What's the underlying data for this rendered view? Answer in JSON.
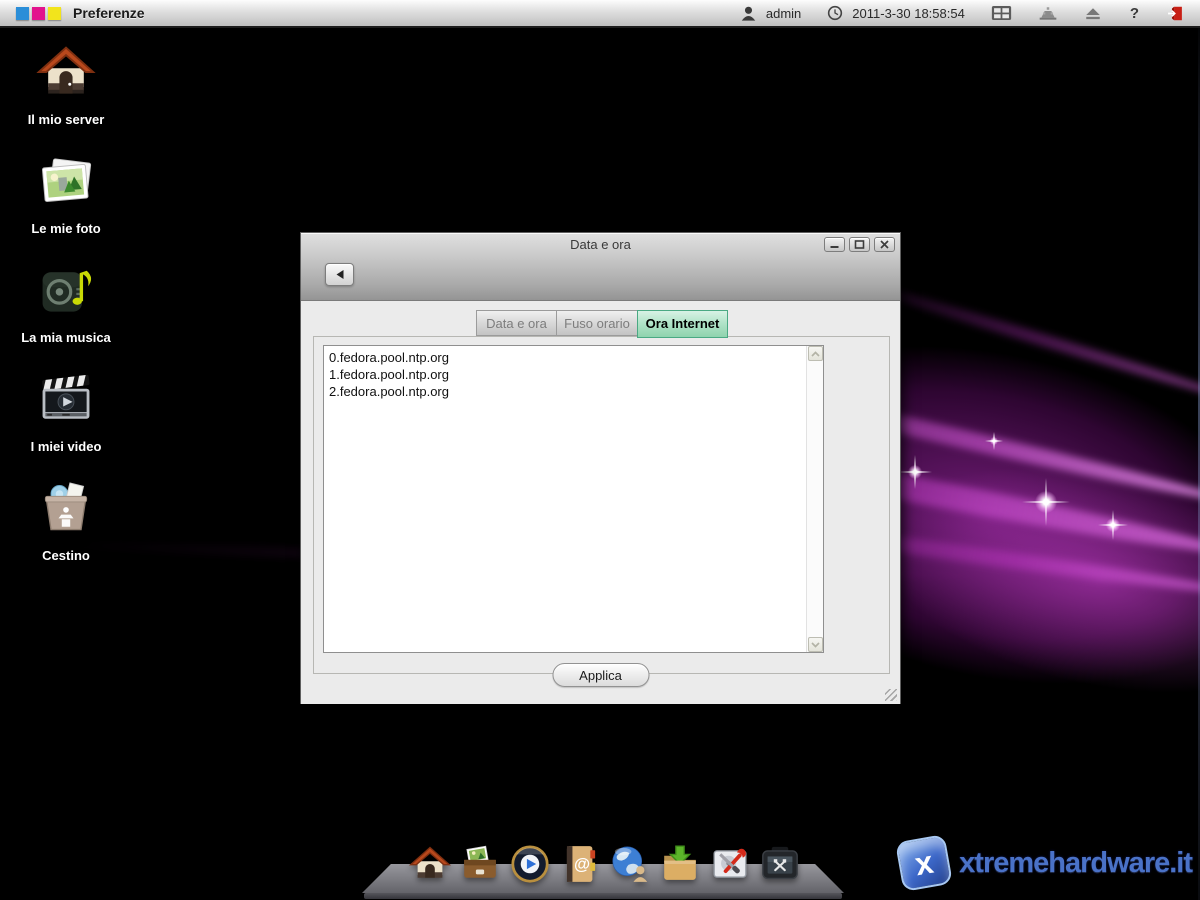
{
  "topbar": {
    "title": "Preferenze",
    "user": "admin",
    "datetime": "2011-3-30 18:58:54",
    "help_label": "?",
    "logo_colors": {
      "blue": "#2b8ed8",
      "magenta": "#e2138d",
      "yellow": "#f2e41c"
    },
    "icons": [
      "user-icon",
      "clock-icon",
      "apps-grid-icon",
      "network-places-icon",
      "eject-icon",
      "help-icon",
      "logout-icon"
    ]
  },
  "desktop": {
    "icons": [
      {
        "label": "Il mio server",
        "icon": "home-icon"
      },
      {
        "label": "Le mie foto",
        "icon": "photos-icon"
      },
      {
        "label": "La mia musica",
        "icon": "music-icon"
      },
      {
        "label": "I miei video",
        "icon": "videos-icon"
      },
      {
        "label": "Cestino",
        "icon": "trash-icon"
      }
    ]
  },
  "dialog": {
    "title": "Data e ora",
    "tabs": [
      {
        "label": "Data e ora",
        "active": false
      },
      {
        "label": "Fuso orario",
        "active": false
      },
      {
        "label": "Ora Internet",
        "active": true
      }
    ],
    "ntp_servers": [
      "0.fedora.pool.ntp.org",
      "1.fedora.pool.ntp.org",
      "2.fedora.pool.ntp.org"
    ],
    "apply_label": "Applica",
    "active_tab_color": "#8fd3ae"
  },
  "dock": {
    "items": [
      "home-icon",
      "photo-box-icon",
      "media-player-icon",
      "contacts-icon",
      "web-icon",
      "download-folder-icon",
      "disk-utility-icon",
      "backup-device-icon"
    ]
  },
  "watermark": {
    "text": "xtremehardware.it"
  }
}
